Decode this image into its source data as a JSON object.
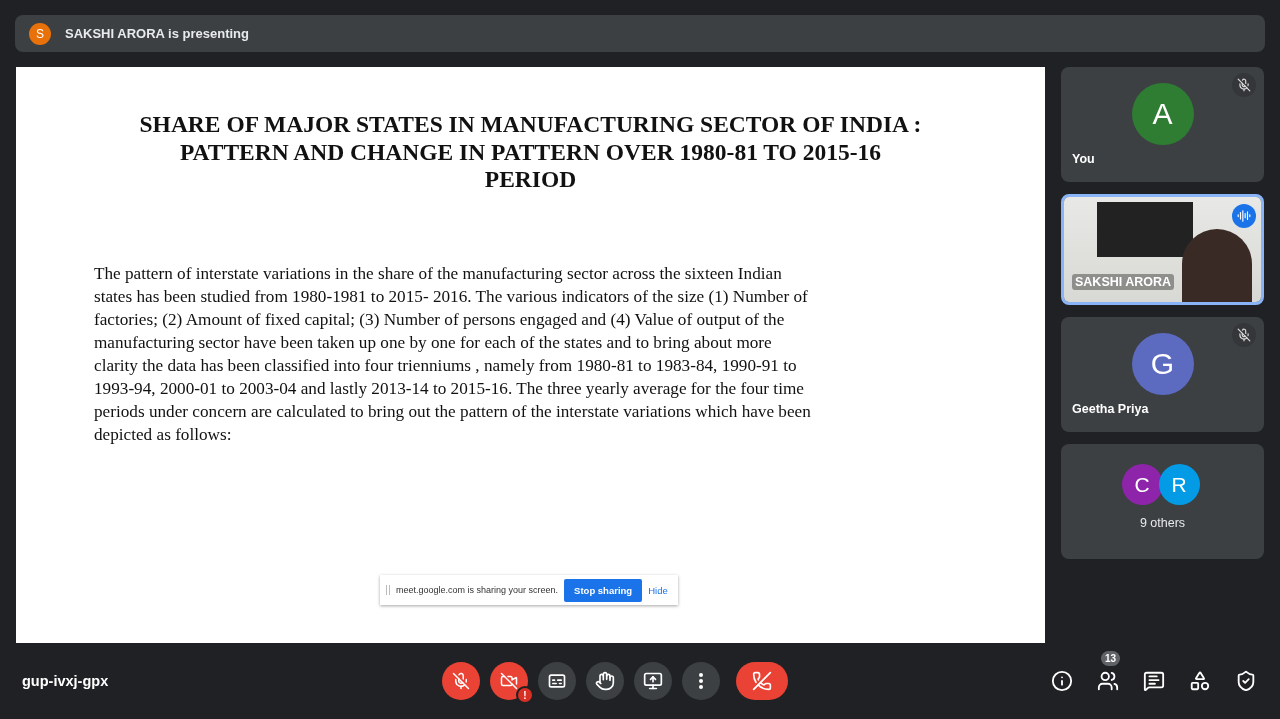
{
  "presenter_bar": {
    "initial": "S",
    "text": "SAKSHI ARORA is presenting"
  },
  "slide": {
    "title": "SHARE OF MAJOR STATES IN MANUFACTURING SECTOR OF INDIA :\nPATTERN AND CHANGE IN PATTERN OVER 1980-81 TO 2015-16\nPERIOD",
    "body": "The pattern of interstate variations in the share of the manufacturing sector across the sixteen Indian\nstates has been studied from 1980-1981 to 2015- 2016. The various indicators of the size (1) Number of\nfactories; (2) Amount of fixed capital; (3) Number of persons engaged and (4) Value of output of the\nmanufacturing sector have been taken up one by one for each of the states and to bring about more\nclarity the data has been classified into four trienniums , namely from 1980-81 to 1983-84, 1990-91 to\n1993-94, 2000-01 to 2003-04 and lastly 2013-14 to 2015-16. The three yearly average for the four time\nperiods under concern are calculated to bring out the pattern of the interstate variations which have been\ndepicted as follows:"
  },
  "share_notice": {
    "text": "meet.google.com is sharing your screen.",
    "stop_button": "Stop sharing",
    "hide_link": "Hide"
  },
  "tiles": [
    {
      "kind": "avatar",
      "name": "You",
      "initial": "A",
      "color": "#2e7d32",
      "muted": true,
      "selected": false
    },
    {
      "kind": "video",
      "name": "SAKSHI ARORA",
      "speaking": true,
      "selected": true
    },
    {
      "kind": "avatar",
      "name": "Geetha Priya",
      "initial": "G",
      "color": "#5c6bc0",
      "muted": true,
      "selected": false
    },
    {
      "kind": "group",
      "label": "9 others",
      "avatars": [
        {
          "initial": "C",
          "color": "#8e24aa"
        },
        {
          "initial": "R",
          "color": "#039be5"
        }
      ],
      "selected": false
    }
  ],
  "meeting_code": "gup-ivxj-gpx",
  "controls": [
    {
      "kind": "mic",
      "on": false
    },
    {
      "kind": "camera",
      "on": false,
      "alert": "!"
    },
    {
      "kind": "captions"
    },
    {
      "kind": "hand"
    },
    {
      "kind": "present"
    },
    {
      "kind": "more"
    },
    {
      "kind": "hangup"
    }
  ],
  "side_buttons": [
    {
      "kind": "info"
    },
    {
      "kind": "people",
      "badge": "13"
    },
    {
      "kind": "chat"
    },
    {
      "kind": "activities"
    },
    {
      "kind": "security"
    }
  ]
}
